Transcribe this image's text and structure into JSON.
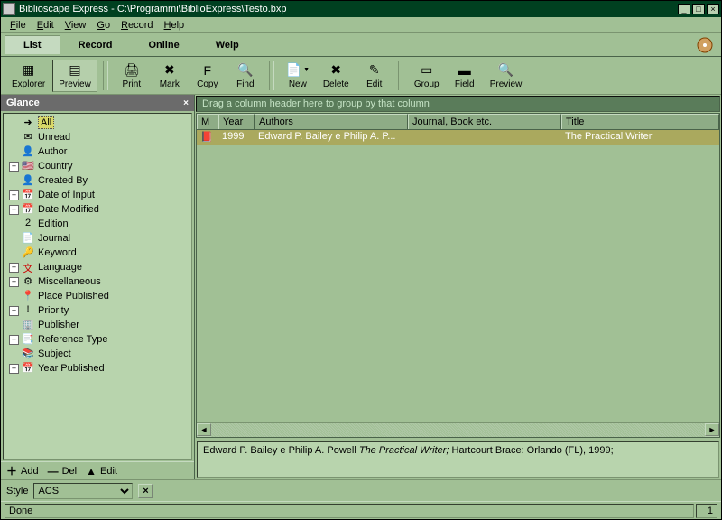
{
  "titlebar": {
    "title": "Biblioscape Express - C:\\Programmi\\BiblioExpress\\Testo.bxp"
  },
  "menu": {
    "file": "File",
    "edit": "Edit",
    "view": "View",
    "go": "Go",
    "record": "Record",
    "help": "Help"
  },
  "tabs": {
    "list": "List",
    "record": "Record",
    "online": "Online",
    "welp": "Welp"
  },
  "toolbar": {
    "explorer": "Explorer",
    "preview": "Preview",
    "print": "Print",
    "mark": "Mark",
    "copy": "Copy",
    "find": "Find",
    "new": "New",
    "delete": "Delete",
    "edit": "Edit",
    "group": "Group",
    "field": "Field",
    "preview2": "Preview"
  },
  "glance": {
    "title": "Glance",
    "items": [
      {
        "exp": null,
        "icon": "➜",
        "label": "All",
        "selected": true
      },
      {
        "exp": null,
        "icon": "✉",
        "label": "Unread"
      },
      {
        "exp": null,
        "icon": "👤",
        "label": "Author"
      },
      {
        "exp": "+",
        "icon": "🇺🇸",
        "label": "Country"
      },
      {
        "exp": null,
        "icon": "👤",
        "label": "Created By"
      },
      {
        "exp": "+",
        "icon": "📅",
        "label": "Date of Input"
      },
      {
        "exp": "+",
        "icon": "📅",
        "label": "Date Modified"
      },
      {
        "exp": null,
        "icon": "2",
        "label": "Edition"
      },
      {
        "exp": null,
        "icon": "📄",
        "label": "Journal"
      },
      {
        "exp": null,
        "icon": "🔑",
        "label": "Keyword"
      },
      {
        "exp": "+",
        "icon": "文",
        "label": "Language"
      },
      {
        "exp": "+",
        "icon": "⚙",
        "label": "Miscellaneous"
      },
      {
        "exp": null,
        "icon": "📍",
        "label": "Place Published"
      },
      {
        "exp": "+",
        "icon": "!",
        "label": "Priority"
      },
      {
        "exp": null,
        "icon": "🏢",
        "label": "Publisher"
      },
      {
        "exp": "+",
        "icon": "📑",
        "label": "Reference Type"
      },
      {
        "exp": null,
        "icon": "📚",
        "label": "Subject"
      },
      {
        "exp": "+",
        "icon": "📅",
        "label": "Year Published"
      }
    ],
    "add": "Add",
    "del": "Del",
    "editbtn": "Edit"
  },
  "style": {
    "label": "Style",
    "value": "ACS"
  },
  "grid": {
    "hint": "Drag a column header here to group by that column",
    "cols": {
      "m": "M",
      "year": "Year",
      "authors": "Authors",
      "journal": "Journal, Book etc.",
      "title": "Title"
    },
    "rows": [
      {
        "m": "📕",
        "year": "1999",
        "authors": "Edward P. Bailey e Philip A. P...",
        "journal": "",
        "title": "The Practical Writer"
      }
    ]
  },
  "citation": {
    "part1": "Edward P. Bailey e Philip A. Powell ",
    "ital": "The Practical Writer;",
    "part2": " Hartcourt Brace: Orlando (FL), 1999;"
  },
  "status": {
    "text": "Done",
    "count": "1"
  }
}
